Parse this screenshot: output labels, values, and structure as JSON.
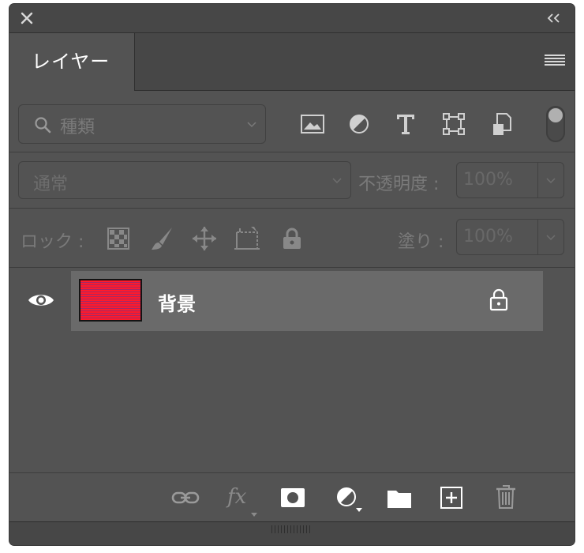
{
  "titlebar": {
    "close_icon": "close-icon",
    "collapse_icon": "double-chevron-left-icon"
  },
  "tab": {
    "label": "レイヤー"
  },
  "filter": {
    "search_icon": "search-icon",
    "kind_label": "種類",
    "filter_icons": [
      "image-icon",
      "adjustment-icon",
      "type-icon",
      "shape-icon",
      "smart-object-icon"
    ],
    "toggle_icon": "filter-toggle-icon"
  },
  "blend": {
    "mode": "通常",
    "opacity_label": "不透明度 :",
    "opacity_value": "100%"
  },
  "lock": {
    "label": "ロック :",
    "icons": [
      "lock-transparent-pixels-icon",
      "lock-image-pixels-icon",
      "lock-position-icon",
      "lock-artboard-icon",
      "lock-all-icon"
    ],
    "fill_label": "塗り :",
    "fill_value": "100%"
  },
  "layers": [
    {
      "name": "背景",
      "visible": true,
      "locked": true,
      "thumb_colors": [
        "#ff1a2a",
        "#a02a6a"
      ]
    }
  ],
  "bottom_icons": [
    "link-icon",
    "fx-icon",
    "mask-icon",
    "adjustment-layer-icon",
    "folder-icon",
    "new-layer-icon",
    "trash-icon"
  ],
  "bottom_labels": {
    "fx": "fx"
  },
  "colors": {
    "panel": "#535353",
    "header": "#474747",
    "selected_row": "#6a6a6a",
    "accent_red": "#ff1a2a"
  }
}
